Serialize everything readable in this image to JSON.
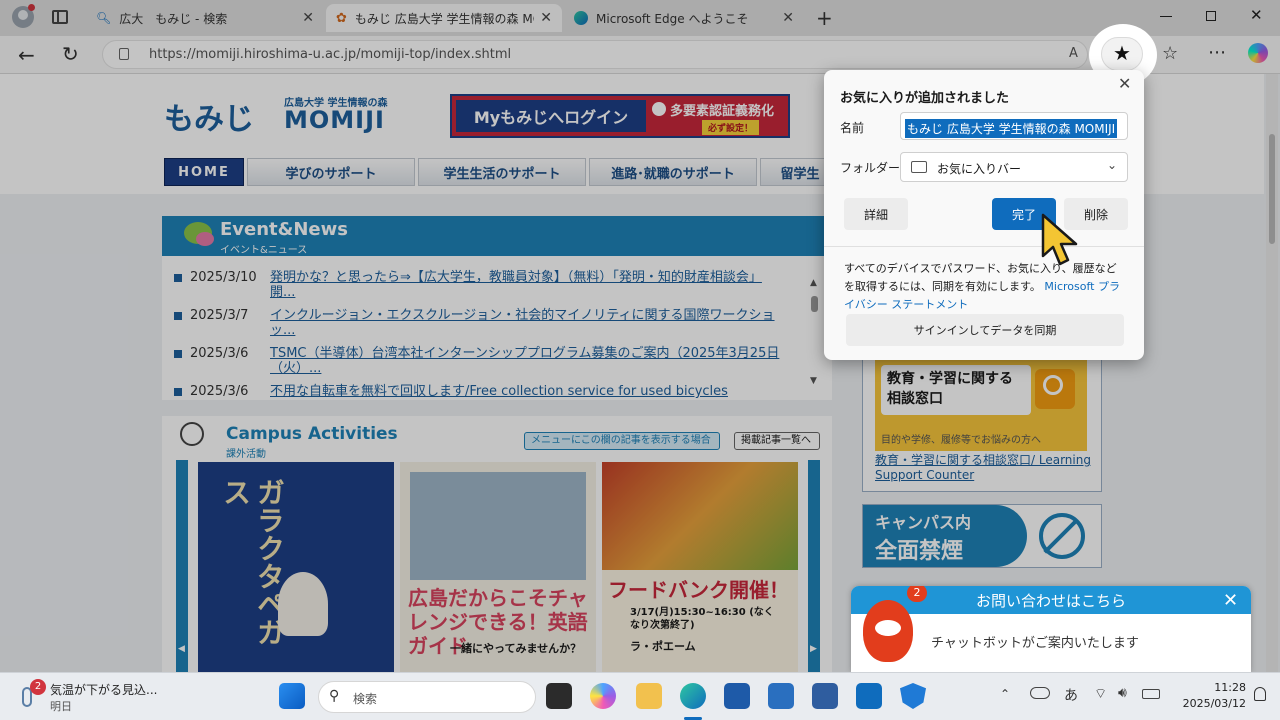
{
  "browser": {
    "tabs": [
      {
        "label": "広大　もみじ - 検索"
      },
      {
        "label": "もみじ 広島大学 学生情報の森 MO"
      },
      {
        "label": "Microsoft Edge へようこそ"
      }
    ],
    "url": "https://momiji.hiroshima-u.ac.jp/momiji-top/index.shtml"
  },
  "site": {
    "logo_main": "もみじ",
    "logo_sub": "広島大学 学生情報の森",
    "logo_en": "MOMIJI",
    "login_label": "Myもみじへログイン",
    "mfa_label": "多要素認証義務化",
    "mfa_badge": "必ず設定！",
    "nav": [
      "HOME",
      "学びのサポート",
      "学生生活のサポート",
      "進路･就職のサポート",
      "留学生"
    ]
  },
  "events": {
    "title": "Event&News",
    "subtitle": "イベント&ニュース",
    "items": [
      {
        "date": "2025/3/10",
        "title": "発明かな？と思ったら⇒【広大学生，教職員対象】（無料）「発明・知的財産相談会」開..."
      },
      {
        "date": "2025/3/7",
        "title": "インクルージョン・エクスクルージョン・社会的マイノリティに関する国際ワークショッ..."
      },
      {
        "date": "2025/3/6",
        "title": "TSMC（半導体）台湾本社インターンシッププログラム募集のご案内（2025年3月25日（火）..."
      },
      {
        "date": "2025/3/6",
        "title": "不用な自転車を無料で回収します/Free collection service for used bicycles"
      }
    ]
  },
  "campus": {
    "title": "Campus Activities",
    "subtitle": "課外活動",
    "menu_link": "メニューにこの欄の記事を表示する場合",
    "list_link": "掲載記事一覧へ",
    "tiles": [
      {
        "text": "ガラクタペガス"
      },
      {
        "text": "広島だからこそチャレンジできる！英語ガイド",
        "sub": "一緒にやってみませんか？"
      },
      {
        "text": "フードバンク開催！",
        "sub": "3/17(月)15:30~16:30 (なくなり次第終了)",
        "tag": "ラ・ポエーム"
      }
    ]
  },
  "side": {
    "consult_title": "教育・学習に関する相談窓口",
    "consult_sub": "目的や学修、履修等でお悩みの方へ",
    "consult_link": "教育・学習に関する相談窓口/ Learning Support Counter",
    "smoke_line1": "キャンパス内",
    "smoke_line2": "全面禁煙"
  },
  "favorite_popup": {
    "title": "お気に入りが追加されました",
    "name_label": "名前",
    "name_value": "もみじ 広島大学 学生情報の森 MOMIJI",
    "folder_label": "フォルダー",
    "folder_value": "お気に入りバー",
    "details_button": "詳細",
    "done_button": "完了",
    "delete_button": "削除",
    "sync_text": "すべてのデバイスでパスワード、お気に入り、履歴などを取得するには、同期を有効にします。",
    "privacy_link": "Microsoft プライバシー ステートメント",
    "signin_button": "サインインしてデータを同期"
  },
  "chat": {
    "title": "お問い合わせはこちら",
    "message": "チャットボットがご案内いたします",
    "badge": "2"
  },
  "taskbar": {
    "weather_badge": "2",
    "weather_text": "気温が下がる見込...",
    "weather_sub": "明日",
    "search_placeholder": "検索",
    "time": "11:28",
    "date": "2025/03/12"
  },
  "colors": {
    "site_blue": "#1d5f9c",
    "edge_blue": "#0f6cbd",
    "chat_blue": "#1f95d6"
  }
}
